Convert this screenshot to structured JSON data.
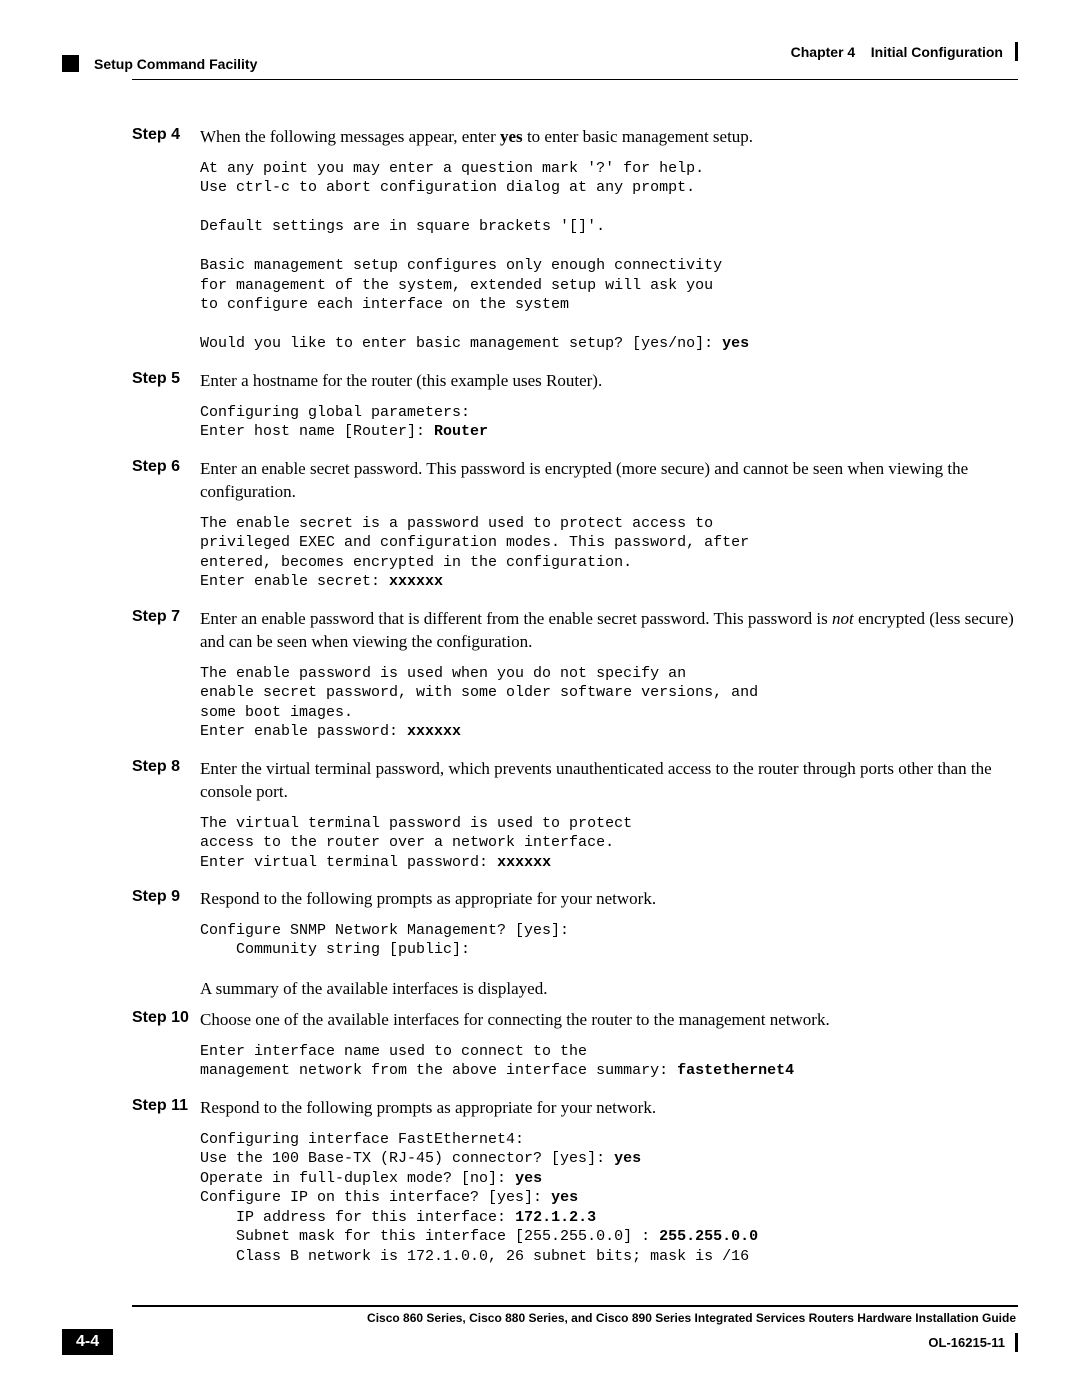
{
  "header": {
    "chapter": "Chapter 4",
    "chapter_title": "Initial Configuration",
    "section": "Setup Command Facility"
  },
  "steps": {
    "s4": {
      "label": "Step 4",
      "text_before": "When the following messages appear, enter ",
      "bold1": "yes",
      "text_after": " to enter basic management setup.",
      "code_lines": [
        "At any point you may enter a question mark '?' for help.",
        "Use ctrl-c to abort configuration dialog at any prompt.",
        "",
        "Default settings are in square brackets '[]'.",
        "",
        "Basic management setup configures only enough connectivity",
        "for management of the system, extended setup will ask you",
        "to configure each interface on the system",
        "",
        "Would you like to enter basic management setup? [yes/no]: "
      ],
      "code_bold_end": "yes"
    },
    "s5": {
      "label": "Step 5",
      "text": "Enter a hostname for the router (this example uses Router).",
      "code_lines": [
        "Configuring global parameters:",
        "Enter host name [Router]: "
      ],
      "code_bold_end": "Router"
    },
    "s6": {
      "label": "Step 6",
      "text": "Enter an enable secret password. This password is encrypted (more secure) and cannot be seen when viewing the configuration.",
      "code_lines": [
        "The enable secret is a password used to protect access to",
        "privileged EXEC and configuration modes. This password, after",
        "entered, becomes encrypted in the configuration.",
        "Enter enable secret: "
      ],
      "code_bold_end": "xxxxxx"
    },
    "s7": {
      "label": "Step 7",
      "text_before": "Enter an enable password that is different from the enable secret password. This password is ",
      "italic1": "not",
      "text_after": " encrypted (less secure) and can be seen when viewing the configuration.",
      "code_lines": [
        "The enable password is used when you do not specify an",
        "enable secret password, with some older software versions, and",
        "some boot images.",
        "Enter enable password: "
      ],
      "code_bold_end": "xxxxxx"
    },
    "s8": {
      "label": "Step 8",
      "text": "Enter the virtual terminal password, which prevents unauthenticated access to the router through ports other than the console port.",
      "code_lines": [
        "The virtual terminal password is used to protect",
        "access to the router over a network interface.",
        "Enter virtual terminal password: "
      ],
      "code_bold_end": "xxxxxx"
    },
    "s9": {
      "label": "Step 9",
      "text": "Respond to the following prompts as appropriate for your network.",
      "code_lines": [
        "Configure SNMP Network Management? [yes]:",
        "    Community string [public]:"
      ],
      "body_after": "A summary of the available interfaces is displayed."
    },
    "s10": {
      "label": "Step 10",
      "text": "Choose one of the available interfaces for connecting the router to the management network.",
      "code_lines": [
        "Enter interface name used to connect to the",
        "management network from the above interface summary: "
      ],
      "code_bold_end": "fastethernet4"
    },
    "s11": {
      "label": "Step 11",
      "text": "Respond to the following prompts as appropriate for your network.",
      "code_composite": [
        {
          "t": "Configuring interface FastEthernet4:\n"
        },
        {
          "t": "Use the 100 Base-TX (RJ-45) connector? [yes]: "
        },
        {
          "b": "yes"
        },
        {
          "t": "\n"
        },
        {
          "t": "Operate in full-duplex mode? [no]: "
        },
        {
          "b": "yes"
        },
        {
          "t": "\n"
        },
        {
          "t": "Configure IP on this interface? [yes]: "
        },
        {
          "b": "yes"
        },
        {
          "t": "\n"
        },
        {
          "t": "    IP address for this interface: "
        },
        {
          "b": "172.1.2.3"
        },
        {
          "t": "\n"
        },
        {
          "t": "    Subnet mask for this interface [255.255.0.0] : "
        },
        {
          "b": "255.255.0.0"
        },
        {
          "t": "\n"
        },
        {
          "t": "    Class B network is 172.1.0.0, 26 subnet bits; mask is /16"
        }
      ]
    }
  },
  "footer": {
    "guide_title": "Cisco 860 Series, Cisco 880 Series, and Cisco 890 Series Integrated Services Routers Hardware Installation Guide",
    "page_num": "4-4",
    "doc_id": "OL-16215-11"
  }
}
